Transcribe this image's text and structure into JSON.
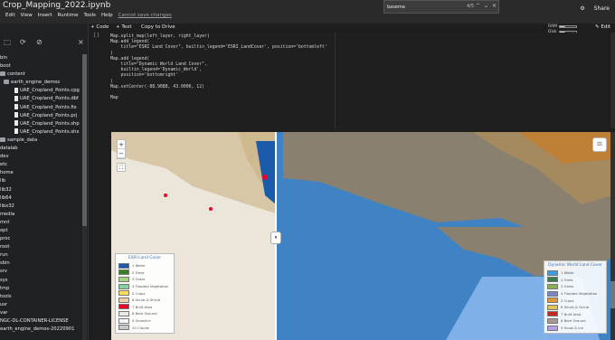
{
  "title": "Crop_Mapping_2022.ipynb",
  "menu": [
    "Edit",
    "View",
    "Insert",
    "Runtime",
    "Tools",
    "Help"
  ],
  "unsaved": "Cannot save changes",
  "find": {
    "value": "basema",
    "count": "4/5"
  },
  "topright": {
    "gear": "⚙",
    "share": "Share"
  },
  "ram_label": "RAM",
  "disk_label": "Disk",
  "edit_label": "Edit",
  "toolbar": {
    "code": "+ Code",
    "text": "+ Text",
    "copy": "Copy to Drive"
  },
  "sidebar": {
    "rows": [
      {
        "label": "bin",
        "type": "folder"
      },
      {
        "label": "boot",
        "type": "folder"
      },
      {
        "label": "content",
        "type": "folder"
      },
      {
        "label": "earth_engine_demos",
        "type": "folder"
      },
      {
        "label": "UAE_Cropland_Points.cpg",
        "type": "file"
      },
      {
        "label": "UAE_Cropland_Points.dbf",
        "type": "file"
      },
      {
        "label": "UAE_Cropland_Points.fix",
        "type": "file"
      },
      {
        "label": "UAE_Cropland_Points.prj",
        "type": "file"
      },
      {
        "label": "UAE_Cropland_Points.shp",
        "type": "file"
      },
      {
        "label": "UAE_Cropland_Points.shx",
        "type": "file"
      },
      {
        "label": "sample_data",
        "type": "folder"
      },
      {
        "label": "datalab",
        "type": "folder"
      },
      {
        "label": "dev",
        "type": "folder"
      },
      {
        "label": "etc",
        "type": "folder"
      },
      {
        "label": "home",
        "type": "folder"
      },
      {
        "label": "lib",
        "type": "folder"
      },
      {
        "label": "lib32",
        "type": "folder"
      },
      {
        "label": "lib64",
        "type": "folder"
      },
      {
        "label": "libx32",
        "type": "folder"
      },
      {
        "label": "media",
        "type": "folder"
      },
      {
        "label": "mnt",
        "type": "folder"
      },
      {
        "label": "opt",
        "type": "folder"
      },
      {
        "label": "proc",
        "type": "folder"
      },
      {
        "label": "root",
        "type": "folder"
      },
      {
        "label": "run",
        "type": "folder"
      },
      {
        "label": "sbin",
        "type": "folder"
      },
      {
        "label": "srv",
        "type": "folder"
      },
      {
        "label": "sys",
        "type": "folder"
      },
      {
        "label": "tmp",
        "type": "folder"
      },
      {
        "label": "tools",
        "type": "folder"
      },
      {
        "label": "usr",
        "type": "folder"
      },
      {
        "label": "var",
        "type": "folder"
      },
      {
        "label": "NGC-DL-CONTAINER-LICENSE",
        "type": "file"
      },
      {
        "label": "earth_engine_demos-20220901",
        "type": "file"
      }
    ]
  },
  "code": {
    "gutter": "[ ]",
    "lines": [
      "Map.split_map(left_layer, right_layer)",
      "Map.add_legend(",
      "    title=\"ESRI Land Cover\", builtin_legend='ESRI_LandCover', position='bottomleft'",
      ")",
      "Map.add_legend(",
      "    title=\"Dynamic World Land Cover\",",
      "    builtin_legend='Dynamic_World',",
      "    position='bottomright'",
      ")",
      "Map.setCenter(-88.9088, 43.0006, 12)",
      "",
      "Map"
    ]
  },
  "legend_left": {
    "title": "ESRI Land Cover",
    "items": [
      {
        "label": "1 Water",
        "color": "#1a5bab"
      },
      {
        "label": "2 Trees",
        "color": "#358221"
      },
      {
        "label": "3 Grass",
        "color": "#a7d282"
      },
      {
        "label": "4 Flooded Vegetation",
        "color": "#87d19e"
      },
      {
        "label": "5 Crops",
        "color": "#ffdb5c"
      },
      {
        "label": "6 Scrub & Shrub",
        "color": "#eecfa8"
      },
      {
        "label": "7 Built Area",
        "color": "#ed022a"
      },
      {
        "label": "8 Bare Ground",
        "color": "#ede9e4"
      },
      {
        "label": "9 Snow/Ice",
        "color": "#f2faff"
      },
      {
        "label": "10 Clouds",
        "color": "#c8c8c8"
      }
    ]
  },
  "legend_right": {
    "title": "Dynamic World Land Cover",
    "items": [
      {
        "label": "1 Water",
        "color": "#419bdf"
      },
      {
        "label": "2 Trees",
        "color": "#397d49"
      },
      {
        "label": "3 Grass",
        "color": "#88b053"
      },
      {
        "label": "4 Flooded Vegetation",
        "color": "#7a87c6"
      },
      {
        "label": "5 Crops",
        "color": "#e49635"
      },
      {
        "label": "6 Shrub & Scrub",
        "color": "#dfc35a"
      },
      {
        "label": "7 Built Area",
        "color": "#c4281b"
      },
      {
        "label": "8 Bare Ground",
        "color": "#a59b8f"
      },
      {
        "label": "9 Snow & Ice",
        "color": "#b39fe1"
      }
    ]
  }
}
